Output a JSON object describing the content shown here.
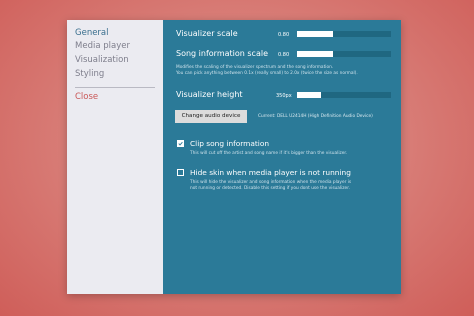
{
  "sidebar": {
    "items": [
      {
        "label": "General"
      },
      {
        "label": "Media player"
      },
      {
        "label": "Visualization"
      },
      {
        "label": "Styling"
      }
    ],
    "close_label": "Close"
  },
  "settings": {
    "visualizer_scale": {
      "label": "Visualizer scale",
      "value_text": "0.80",
      "fraction": 0.38
    },
    "song_info_scale": {
      "label": "Song information scale",
      "value_text": "0.80",
      "fraction": 0.38
    },
    "scale_desc": [
      "Modifies the scaling of the visualizer spectrum and the song information.",
      "You can pick anything between 0.1x (really small) to 2.0x (twice the size as normal)."
    ],
    "visualizer_height": {
      "label": "Visualizer height",
      "value_text": "350px",
      "fraction": 0.26
    },
    "audio_button_label": "Change audio device",
    "current_device": "Current: DELL U2414H (High Definition Audio Device)",
    "clip_song": {
      "label": "Clip song information",
      "checked": true,
      "desc": "This will cut off the artist and song name if it's bigger than the visualizer."
    },
    "hide_skin": {
      "label": "Hide skin when media player is not running",
      "checked": false,
      "desc": [
        "This will hide the visualizer and song information when the media player is",
        "not running or detected. Disable this setting if you dont use the visualizer."
      ]
    }
  },
  "colors": {
    "panel": "#2b7a98",
    "sidebar": "#ebebf1",
    "active": "#3a6f8e",
    "close": "#c95757"
  }
}
